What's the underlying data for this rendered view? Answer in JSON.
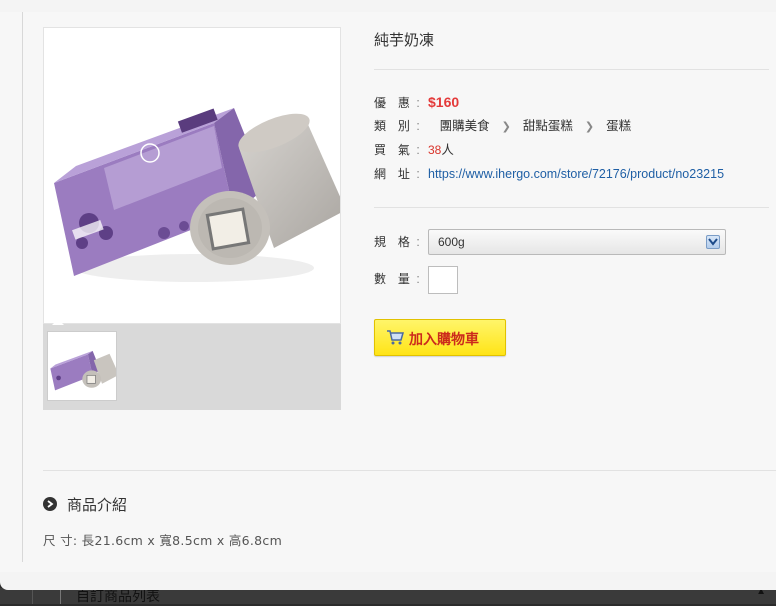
{
  "product": {
    "title": "純芋奶凍",
    "price_label": "優 惠",
    "price": "$160",
    "category_label": "類 別",
    "categories": [
      "團購美食",
      "甜點蛋糕",
      "蛋糕"
    ],
    "popularity_label": "買 氣",
    "popularity_count": "38",
    "popularity_unit": "人",
    "url_label": "網 址",
    "url": "https://www.ihergo.com/store/72176/product/no23215"
  },
  "options": {
    "spec_label": "規 格",
    "spec_value": "600g",
    "qty_label": "數 量",
    "qty_value": ""
  },
  "cart_button": {
    "label": "加入購物車"
  },
  "description": {
    "section_title": "商品介紹",
    "size_text": "尺 寸: 長21.6cm x 寬8.5cm x 高6.8cm"
  },
  "backdrop": {
    "text": "自訂商品列表"
  },
  "colors": {
    "price": "#e43a3a",
    "link": "#1f5fa5",
    "cart_button": "#ffe417",
    "cart_text": "#cc2a1c",
    "box_purple": "#9b7cc0"
  },
  "icons": [
    "cart-icon",
    "chevron-right-icon",
    "dropdown-arrow-icon",
    "circle-arrow-icon"
  ]
}
